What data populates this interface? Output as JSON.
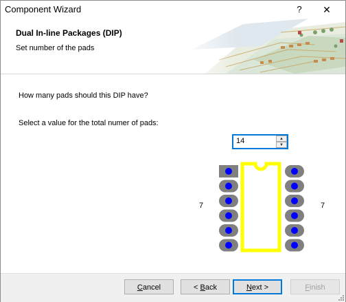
{
  "window": {
    "title": "Component Wizard",
    "help_glyph": "?",
    "close_glyph": "✕"
  },
  "header": {
    "title": "Dual In-line Packages (DIP)",
    "subtitle": "Set number of the pads"
  },
  "main": {
    "question": "How many pads should this DIP have?",
    "select_label": "Select a value for the total numer of pads:",
    "pad_total": "14",
    "left_count": "7",
    "right_count": "7",
    "pads_per_side": 7
  },
  "colors": {
    "outline": "#ffff00",
    "pad": "#808080",
    "hole": "#0000ff",
    "accent": "#0078d7"
  },
  "footer": {
    "cancel_prefix": "",
    "cancel_key": "C",
    "cancel_rest": "ancel",
    "back_prefix": "< ",
    "back_key": "B",
    "back_rest": "ack",
    "next_key": "N",
    "next_rest": "ext >",
    "finish_key": "F",
    "finish_rest": "inish"
  }
}
